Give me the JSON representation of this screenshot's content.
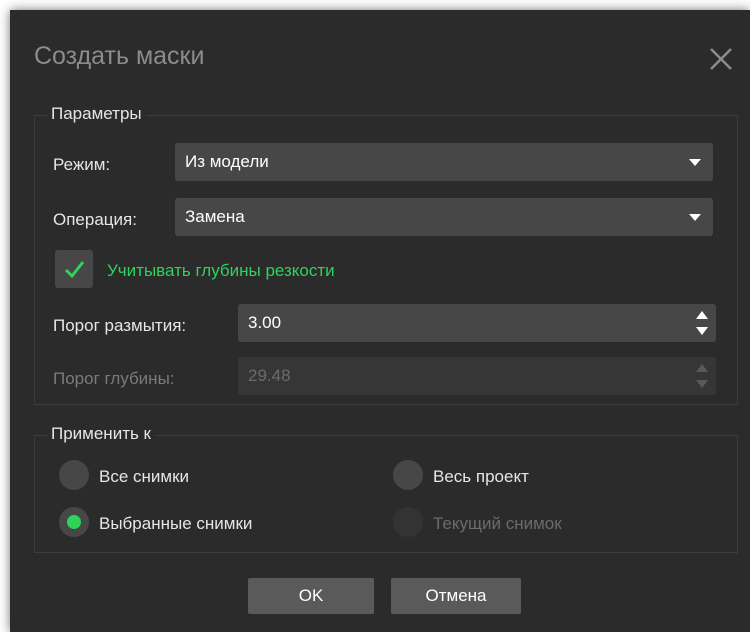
{
  "dialog": {
    "title": "Создать маски"
  },
  "params": {
    "group_title": "Параметры",
    "mode_label": "Режим:",
    "mode_value": "Из модели",
    "operation_label": "Операция:",
    "operation_value": "Замена",
    "depth_of_field_label": "Учитывать глубины резкости",
    "depth_of_field_checked": true,
    "blur_threshold_label": "Порог размытия:",
    "blur_threshold_value": "3.00",
    "depth_threshold_label": "Порог глубины:",
    "depth_threshold_value": "29.48"
  },
  "apply_to": {
    "group_title": "Применить к",
    "options": [
      {
        "label": "Все снимки",
        "selected": false,
        "enabled": true
      },
      {
        "label": "Весь проект",
        "selected": false,
        "enabled": true
      },
      {
        "label": "Выбранные снимки",
        "selected": true,
        "enabled": true
      },
      {
        "label": "Текущий снимок",
        "selected": false,
        "enabled": false
      }
    ]
  },
  "buttons": {
    "ok_label": "OK",
    "cancel_label": "Отмена"
  },
  "colors": {
    "accent": "#2ed35a",
    "background": "#2b2b2b",
    "field": "#474747"
  }
}
